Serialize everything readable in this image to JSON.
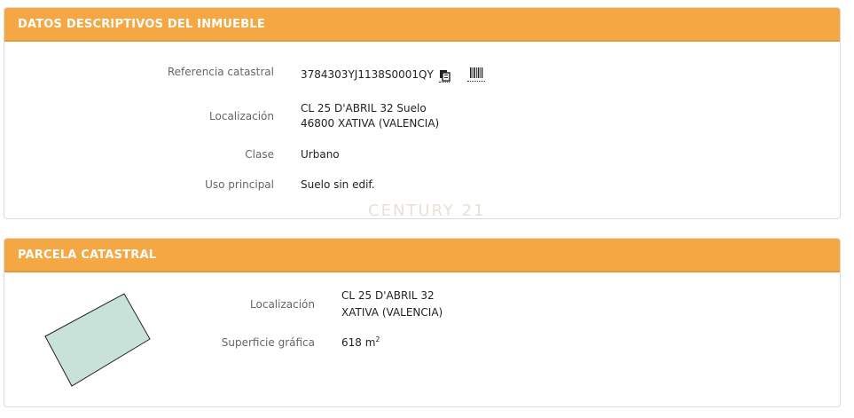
{
  "panel1": {
    "title": "DATOS DESCRIPTIVOS DEL INMUEBLE",
    "rows": {
      "referencia_label": "Referencia catastral",
      "referencia_value": "3784303YJ1138S0001QY",
      "localizacion_label": "Localización",
      "localizacion_line1": "CL 25 D'ABRIL 32 Suelo",
      "localizacion_line2": "46800 XATIVA (VALENCIA)",
      "clase_label": "Clase",
      "clase_value": "Urbano",
      "uso_label": "Uso principal",
      "uso_value": "Suelo sin edif."
    },
    "icons": [
      "copy-icon",
      "barcode-icon"
    ]
  },
  "watermark": "CENTURY 21",
  "panel2": {
    "title": "PARCELA CATASTRAL",
    "rows": {
      "localizacion_label": "Localización",
      "localizacion_line1": "CL 25 D'ABRIL 32",
      "localizacion_line2": "XATIVA (VALENCIA)",
      "superficie_label": "Superficie gráfica",
      "superficie_value": "618 m",
      "superficie_unit_exp": "2"
    },
    "parcel_fill": "#c9e2d9",
    "parcel_stroke": "#222222"
  },
  "colors": {
    "header_bg": "#f4a742",
    "header_text": "#ffffff"
  }
}
